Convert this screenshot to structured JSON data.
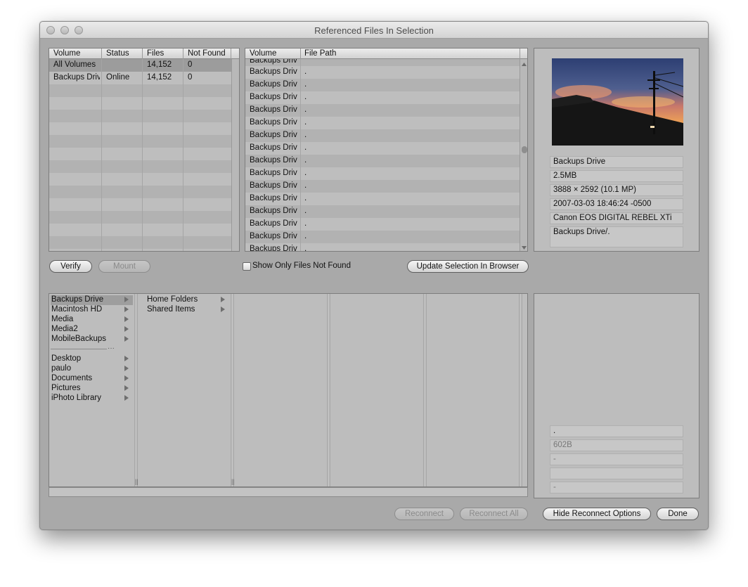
{
  "window": {
    "title": "Referenced Files In Selection"
  },
  "volumes_table": {
    "headers": [
      "Volume",
      "Status",
      "Files",
      "Not Found"
    ],
    "rows": [
      [
        "All Volumes",
        "",
        "14,152",
        "0"
      ],
      [
        "Backups Driv",
        "Online",
        "14,152",
        "0"
      ]
    ]
  },
  "files_table": {
    "headers": [
      "Volume",
      "File Path"
    ],
    "partial_top": "Backups Driv",
    "rows": [
      [
        "Backups Driv",
        "."
      ],
      [
        "Backups Driv",
        "."
      ],
      [
        "Backups Driv",
        "."
      ],
      [
        "Backups Driv",
        "."
      ],
      [
        "Backups Driv",
        "."
      ],
      [
        "Backups Driv",
        "."
      ],
      [
        "Backups Driv",
        "."
      ],
      [
        "Backups Driv",
        "."
      ],
      [
        "Backups Driv",
        "."
      ],
      [
        "Backups Driv",
        "."
      ],
      [
        "Backups Driv",
        "."
      ],
      [
        "Backups Driv",
        "."
      ],
      [
        "Backups Driv",
        "."
      ],
      [
        "Backups Driv",
        "."
      ],
      [
        "Backups Driv",
        "."
      ]
    ],
    "partial_bottom": "Backups Driv"
  },
  "preview": {
    "volume": "Backups Drive",
    "size": "2.5MB",
    "dimensions": "3888 × 2592 (10.1 MP)",
    "date": "2007-03-03 18:46:24 -0500",
    "camera": "Canon EOS DIGITAL REBEL XTi",
    "path": "Backups Drive/."
  },
  "buttons": {
    "verify": "Verify",
    "mount": "Mount",
    "update_selection": "Update Selection In Browser",
    "reconnect": "Reconnect",
    "reconnect_all": "Reconnect All",
    "hide_reconnect": "Hide Reconnect Options",
    "done": "Done"
  },
  "checkbox": {
    "label": "Show Only Files Not Found",
    "checked": false
  },
  "browser": {
    "column1_volumes": [
      "Backups Drive",
      "Macintosh HD",
      "Media",
      "Media2",
      "MobileBackups"
    ],
    "column1_places": [
      "Desktop",
      "paulo",
      "Documents",
      "Pictures",
      "iPhoto Library"
    ],
    "column2": [
      "Home Folders",
      "Shared Items"
    ]
  },
  "reconnect_info": {
    "name": ".",
    "size": "602B",
    "field3": "-",
    "field4": "",
    "field5": "-"
  }
}
